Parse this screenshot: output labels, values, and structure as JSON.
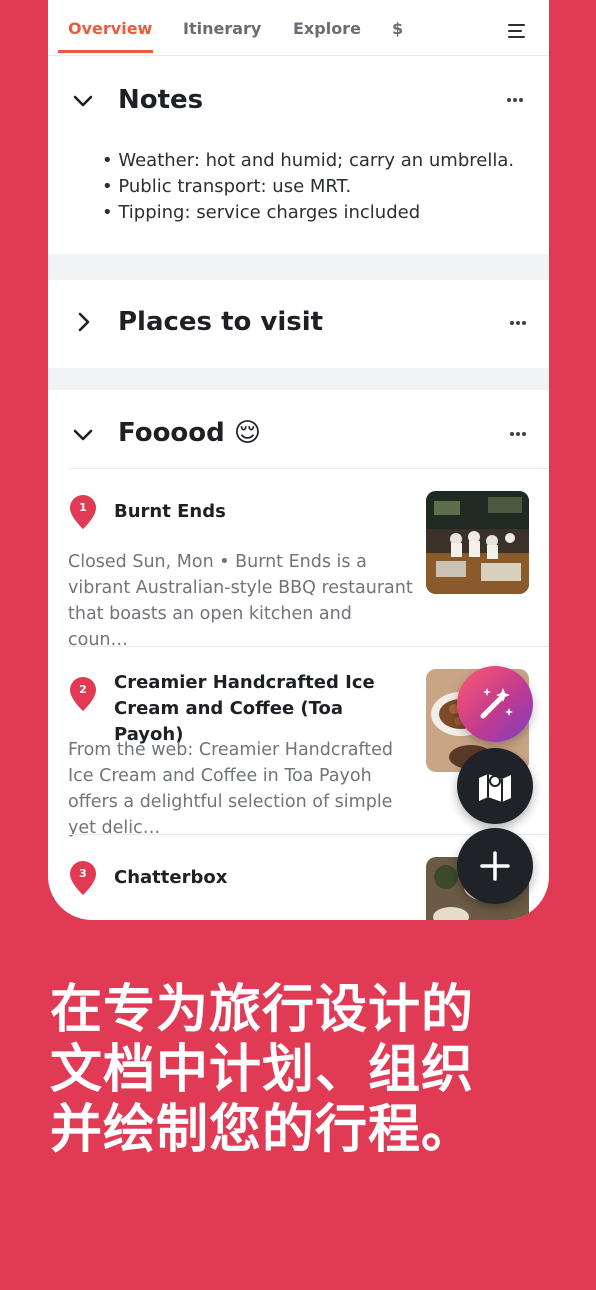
{
  "tabs": [
    {
      "label": "Overview",
      "active": true
    },
    {
      "label": "Itinerary",
      "active": false
    },
    {
      "label": "Explore",
      "active": false
    },
    {
      "label": "$",
      "active": false
    }
  ],
  "sections": {
    "notes": {
      "title": "Notes",
      "expanded": true,
      "items": [
        "Weather: hot and humid; carry an umbrella.",
        "Public transport: use MRT.",
        "Tipping: service charges included"
      ]
    },
    "places": {
      "title": "Places to visit",
      "expanded": false
    },
    "food": {
      "title": "Fooood 😌",
      "expanded": true,
      "places": [
        {
          "number": "1",
          "name": "Burnt Ends",
          "description": "Closed Sun, Mon • Burnt Ends is a vibrant Australian-style BBQ restaurant that boasts an open kitchen and coun…"
        },
        {
          "number": "2",
          "name": "Creamier Handcrafted Ice Cream and Coffee (Toa Payoh)",
          "description": "From the web: Creamier Handcrafted Ice Cream and Coffee in Toa Payoh offers a delightful selection of simple yet delic…"
        },
        {
          "number": "3",
          "name": "Chatterbox",
          "description": ""
        }
      ]
    }
  },
  "caption": {
    "line1": "在专为旅行设计的",
    "line2": "文档中计划、组织",
    "line3": "并绘制您的行程。"
  },
  "icons": {
    "fab_magic": "magic-wand-icon",
    "fab_map": "map-icon",
    "fab_add": "plus-icon"
  },
  "colors": {
    "background": "#e03a55",
    "accent": "#ea5b3f",
    "pin": "#e03a55",
    "fab_dark": "#1f2227"
  }
}
